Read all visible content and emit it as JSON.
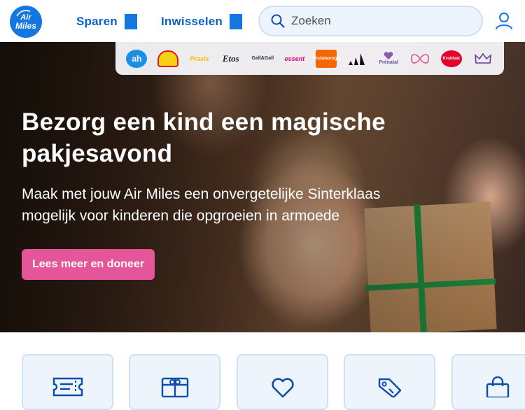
{
  "header": {
    "logo_line1": "Air",
    "logo_line2": "Miles",
    "nav": [
      {
        "label": "Sparen"
      },
      {
        "label": "Inwisselen"
      }
    ],
    "search_placeholder": "Zoeken"
  },
  "partners": [
    {
      "name": "Albert Heijn",
      "text": "ah"
    },
    {
      "name": "Shell",
      "text": ""
    },
    {
      "name": "Praxis",
      "text": "Praxis"
    },
    {
      "name": "Etos",
      "text": "Etos"
    },
    {
      "name": "Gall & Gall",
      "text": "Gall&Gall"
    },
    {
      "name": "essent",
      "text": "essent"
    },
    {
      "name": "Thuisbezorgd",
      "text": "Thuisbezorgd"
    },
    {
      "name": "adidas",
      "text": ""
    },
    {
      "name": "Prénatal",
      "text": "Prénatal"
    },
    {
      "name": "Hunkemöller",
      "text": ""
    },
    {
      "name": "Kruidvat",
      "text": "Kruidvat"
    },
    {
      "name": "Crown",
      "text": ""
    }
  ],
  "hero": {
    "title": "Bezorg een kind een magische pakjesavond",
    "subtitle": "Maak met jouw Air Miles een onvergetelijke Sinterklaas mogelijk voor kinderen die opgroeien in armoede",
    "cta_label": "Lees meer en doneer"
  },
  "cards": [
    {
      "icon": "ticket-icon"
    },
    {
      "icon": "gift-card-icon"
    },
    {
      "icon": "heart-icon"
    },
    {
      "icon": "tag-icon"
    },
    {
      "icon": "shopping-bag-icon"
    }
  ],
  "colors": {
    "brand_blue": "#1477e0",
    "nav_text": "#0a62c9",
    "cta_pink": "#e5559a",
    "card_bg": "#eef4fb",
    "card_border": "#cfe0f4"
  }
}
